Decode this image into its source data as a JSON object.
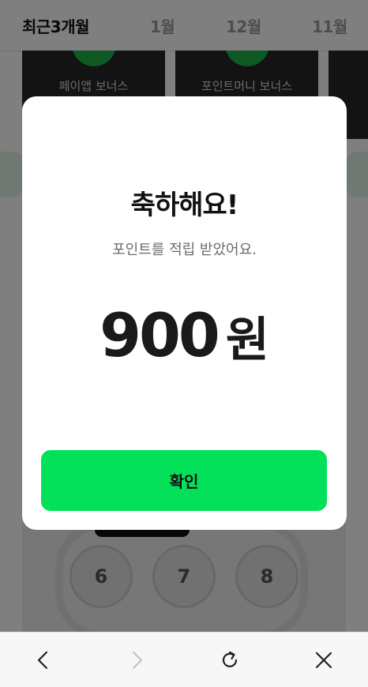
{
  "tabs": [
    {
      "label": "최근3개월",
      "active": true
    },
    {
      "label": "1월",
      "active": false
    },
    {
      "label": "12월",
      "active": false
    },
    {
      "label": "11월",
      "active": false
    }
  ],
  "bonus_cards": [
    {
      "label": "페이앱 보너스"
    },
    {
      "label": "포인트머니 보너스"
    }
  ],
  "steps": [
    "6",
    "7",
    "8"
  ],
  "modal": {
    "title": "축하해요!",
    "subtitle": "포인트를 적립 받았어요.",
    "amount": "900",
    "unit": "원",
    "confirm_label": "확인"
  },
  "colors": {
    "accent_green": "#03e15a",
    "card_dark": "#262626"
  },
  "toolbar": {
    "back_icon": "chevron-left-icon",
    "forward_icon": "chevron-right-icon",
    "reload_icon": "reload-icon",
    "close_icon": "close-icon"
  }
}
